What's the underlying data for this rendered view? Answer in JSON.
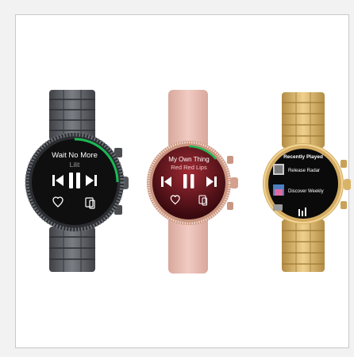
{
  "watches": [
    {
      "name": "watch-gunmetal",
      "song_title": "Wait No More",
      "artist": "Lilit",
      "colors": {
        "band": "#5d6066",
        "case": "#3e4044",
        "screen": "#111111",
        "progress": "#1db954"
      }
    },
    {
      "name": "watch-rose-gold",
      "song_title": "My Own Thing",
      "artist": "Red Red Lips",
      "colors": {
        "band": "#e5b7ad",
        "case": "#d9a894",
        "screen": "#7a1b24",
        "progress": "#1db954"
      }
    },
    {
      "name": "watch-gold",
      "header": "Recently Played",
      "list": [
        {
          "label": "Release Radar"
        },
        {
          "label": "Discover Weekly"
        }
      ],
      "colors": {
        "band": "#caa865",
        "case": "#d6b06a",
        "screen": "#0a0a0a",
        "progress": "#1db954"
      }
    }
  ]
}
